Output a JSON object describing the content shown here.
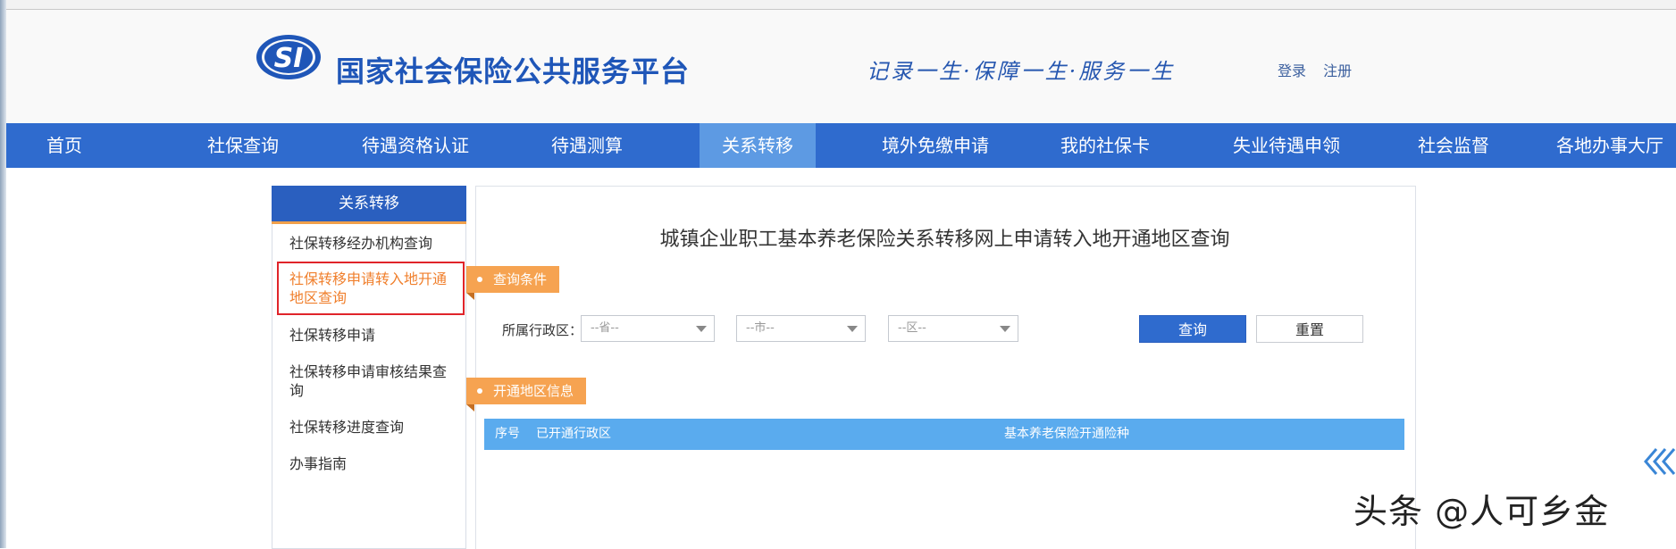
{
  "header": {
    "site_title": "国家社会保险公共服务平台",
    "logo_text": "SI",
    "slogan": "记录一生·保障一生·服务一生",
    "login": "登录",
    "register": "注册"
  },
  "nav": {
    "items": [
      {
        "label": "首页"
      },
      {
        "label": "社保查询"
      },
      {
        "label": "待遇资格认证"
      },
      {
        "label": "待遇测算"
      },
      {
        "label": "关系转移"
      },
      {
        "label": "境外免缴申请"
      },
      {
        "label": "我的社保卡"
      },
      {
        "label": "失业待遇申领"
      },
      {
        "label": "社会监督"
      },
      {
        "label": "各地办事大厅"
      }
    ],
    "active": "关系转移"
  },
  "sidebar": {
    "title": "关系转移",
    "items": [
      {
        "label": "社保转移经办机构查询"
      },
      {
        "label": "社保转移申请转入地开通地区查询"
      },
      {
        "label": "社保转移申请"
      },
      {
        "label": "社保转移申请审核结果查询"
      },
      {
        "label": "社保转移进度查询"
      },
      {
        "label": "办事指南"
      }
    ]
  },
  "main": {
    "title": "城镇企业职工基本养老保险关系转移网上申请转入地开通地区查询",
    "query_tag": "查询条件",
    "region_label": "所属行政区：",
    "province_placeholder": "--省--",
    "city_placeholder": "--市--",
    "district_placeholder": "--区--",
    "query_button": "查询",
    "reset_button": "重置",
    "result_tag": "开通地区信息",
    "table_headers": [
      "序号",
      "已开通行政区",
      "基本养老保险开通险种"
    ]
  },
  "watermark": {
    "brand": "头条 @人可乡金"
  },
  "colors": {
    "nav_bg": "#2f6bce",
    "nav_active": "#5d9ae3",
    "accent_orange": "#f6a351",
    "table_head": "#5aabee",
    "active_outline": "#e0242a"
  }
}
